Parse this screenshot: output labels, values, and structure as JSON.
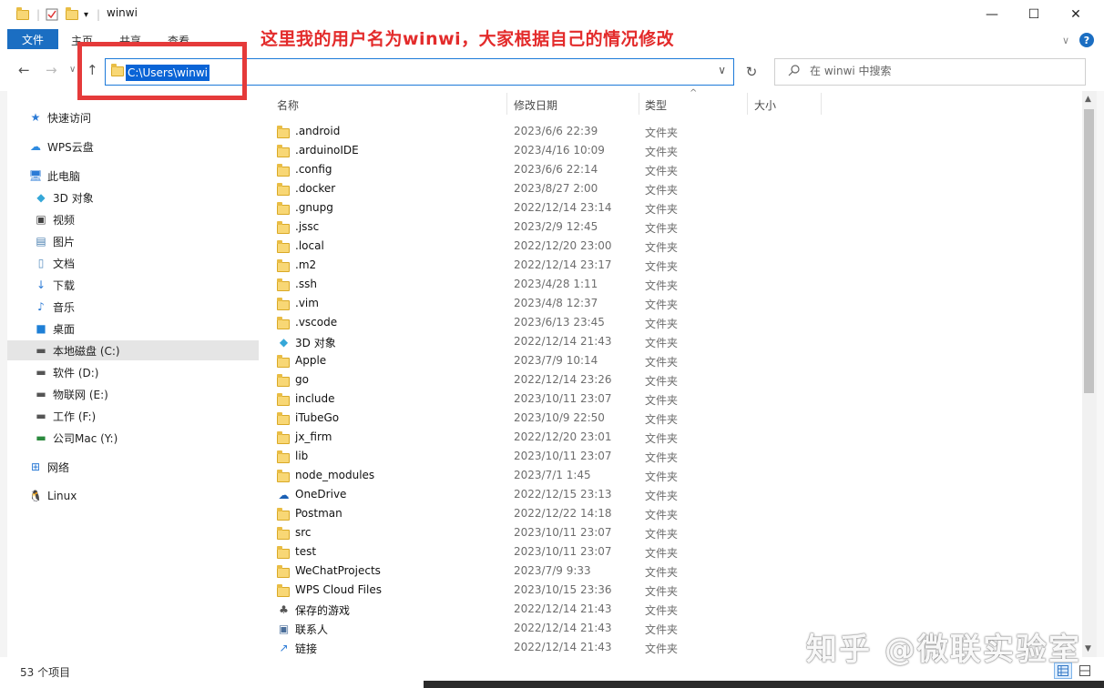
{
  "window": {
    "title": "winwi",
    "minimize": "—",
    "maximize": "☐",
    "close": "✕",
    "annotation": "这里我的用户名为winwi，大家根据自己的情况修改"
  },
  "ribbon": {
    "tabs": [
      "文件",
      "主页",
      "共享",
      "查看"
    ],
    "expand": "∨",
    "help": "?"
  },
  "nav": {
    "back": "←",
    "forward": "→",
    "recent": "∨",
    "up": "↑",
    "refresh": "↻"
  },
  "address": {
    "path": "C:\\Users\\winwi",
    "dropdown": "∨"
  },
  "search": {
    "placeholder": "在 winwi 中搜索"
  },
  "sidebar": {
    "items": [
      {
        "label": "快速访问",
        "icon": "★"
      },
      {
        "label": "WPS云盘",
        "icon": "☁"
      },
      {
        "label": "此电脑",
        "icon": "🖥"
      },
      {
        "label": "3D 对象",
        "icon": "◆"
      },
      {
        "label": "视频",
        "icon": "▣"
      },
      {
        "label": "图片",
        "icon": "▤"
      },
      {
        "label": "文档",
        "icon": "▯"
      },
      {
        "label": "下载",
        "icon": "↓"
      },
      {
        "label": "音乐",
        "icon": "♪"
      },
      {
        "label": "桌面",
        "icon": "■"
      },
      {
        "label": "本地磁盘 (C:)",
        "icon": "▬"
      },
      {
        "label": "软件 (D:)",
        "icon": "▬"
      },
      {
        "label": "物联网 (E:)",
        "icon": "▬"
      },
      {
        "label": "工作 (F:)",
        "icon": "▬"
      },
      {
        "label": "公司Mac (Y:)",
        "icon": "▬"
      },
      {
        "label": "网络",
        "icon": "⊞"
      },
      {
        "label": "Linux",
        "icon": "🐧"
      }
    ]
  },
  "columns": {
    "name": "名称",
    "date": "修改日期",
    "type": "类型",
    "size": "大小",
    "sort_indicator": "^"
  },
  "files": [
    {
      "name": ".android",
      "date": "2023/6/6 22:39",
      "type": "文件夹"
    },
    {
      "name": ".arduinoIDE",
      "date": "2023/4/16 10:09",
      "type": "文件夹"
    },
    {
      "name": ".config",
      "date": "2023/6/6 22:14",
      "type": "文件夹"
    },
    {
      "name": ".docker",
      "date": "2023/8/27 2:00",
      "type": "文件夹"
    },
    {
      "name": ".gnupg",
      "date": "2022/12/14 23:14",
      "type": "文件夹"
    },
    {
      "name": ".jssc",
      "date": "2023/2/9 12:45",
      "type": "文件夹"
    },
    {
      "name": ".local",
      "date": "2022/12/20 23:00",
      "type": "文件夹"
    },
    {
      "name": ".m2",
      "date": "2022/12/14 23:17",
      "type": "文件夹"
    },
    {
      "name": ".ssh",
      "date": "2023/4/28 1:11",
      "type": "文件夹"
    },
    {
      "name": ".vim",
      "date": "2023/4/8 12:37",
      "type": "文件夹"
    },
    {
      "name": ".vscode",
      "date": "2023/6/13 23:45",
      "type": "文件夹"
    },
    {
      "name": "3D 对象",
      "date": "2022/12/14 21:43",
      "type": "文件夹"
    },
    {
      "name": "Apple",
      "date": "2023/7/9 10:14",
      "type": "文件夹"
    },
    {
      "name": "go",
      "date": "2022/12/14 23:26",
      "type": "文件夹"
    },
    {
      "name": "include",
      "date": "2023/10/11 23:07",
      "type": "文件夹"
    },
    {
      "name": "iTubeGo",
      "date": "2023/10/9 22:50",
      "type": "文件夹"
    },
    {
      "name": "jx_firm",
      "date": "2022/12/20 23:01",
      "type": "文件夹"
    },
    {
      "name": "lib",
      "date": "2023/10/11 23:07",
      "type": "文件夹"
    },
    {
      "name": "node_modules",
      "date": "2023/7/1 1:45",
      "type": "文件夹"
    },
    {
      "name": "OneDrive",
      "date": "2022/12/15 23:13",
      "type": "文件夹"
    },
    {
      "name": "Postman",
      "date": "2022/12/22 14:18",
      "type": "文件夹"
    },
    {
      "name": "src",
      "date": "2023/10/11 23:07",
      "type": "文件夹"
    },
    {
      "name": "test",
      "date": "2023/10/11 23:07",
      "type": "文件夹"
    },
    {
      "name": "WeChatProjects",
      "date": "2023/7/9 9:33",
      "type": "文件夹"
    },
    {
      "name": "WPS Cloud Files",
      "date": "2023/10/15 23:36",
      "type": "文件夹"
    },
    {
      "name": "保存的游戏",
      "date": "2022/12/14 21:43",
      "type": "文件夹"
    },
    {
      "name": "联系人",
      "date": "2022/12/14 21:43",
      "type": "文件夹"
    },
    {
      "name": "链接",
      "date": "2022/12/14 21:43",
      "type": "文件夹"
    }
  ],
  "file_icons": {
    "3D 对象": "◆",
    "OneDrive": "☁",
    "保存的游戏": "♣",
    "联系人": "▣",
    "链接": "↗"
  },
  "status": {
    "count": "53 个项目"
  },
  "watermark": "知乎 @微联实验室",
  "colors": {
    "accent": "#1b6ec2",
    "selection": "#0a64d6",
    "annotation": "#e32b2b",
    "folder": "#f8d775"
  }
}
